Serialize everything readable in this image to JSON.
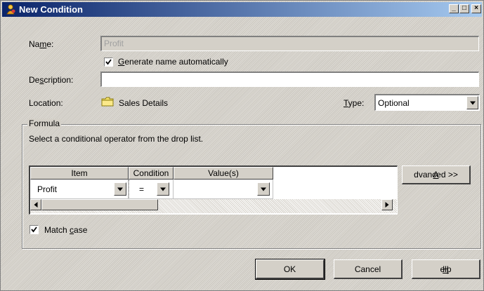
{
  "window": {
    "title": "New Condition",
    "controls": {
      "minimize": "_",
      "maximize": "□",
      "close": "×"
    }
  },
  "form": {
    "name_label_pre": "Na",
    "name_label_key": "m",
    "name_label_post": "e:",
    "name_value": "Profit",
    "auto_name_pre": "",
    "auto_name_key": "G",
    "auto_name_post": "enerate name automatically",
    "auto_name_checked": true,
    "description_label_pre": "De",
    "description_label_key": "s",
    "description_label_post": "cription:",
    "description_value": "",
    "location_label": "Location:",
    "location_value": "Sales Details",
    "type_label_key": "T",
    "type_label_post": "ype:",
    "type_value": "Optional"
  },
  "formula": {
    "group_label": "Formula",
    "instruction": "Select a conditional operator from the drop list.",
    "columns": [
      "Item",
      "Condition",
      "Value(s)"
    ],
    "rows": [
      {
        "item": "Profit",
        "condition": "=",
        "value": ""
      }
    ],
    "advanced_pre": "",
    "advanced_key": "A",
    "advanced_post": "dvanced >>",
    "match_case_pre": "Match ",
    "match_case_key": "c",
    "match_case_post": "ase",
    "match_case_checked": true
  },
  "buttons": {
    "ok": "OK",
    "cancel": "Cancel",
    "help_key": "H",
    "help_post": "elp"
  },
  "colors": {
    "title_start": "#0a246a",
    "title_end": "#a6caf0",
    "face": "#d4d0c8"
  },
  "icons": [
    "condition-icon",
    "folder-icon",
    "check-icon",
    "dropdown-arrow-icon",
    "scroll-left-icon",
    "scroll-right-icon"
  ]
}
